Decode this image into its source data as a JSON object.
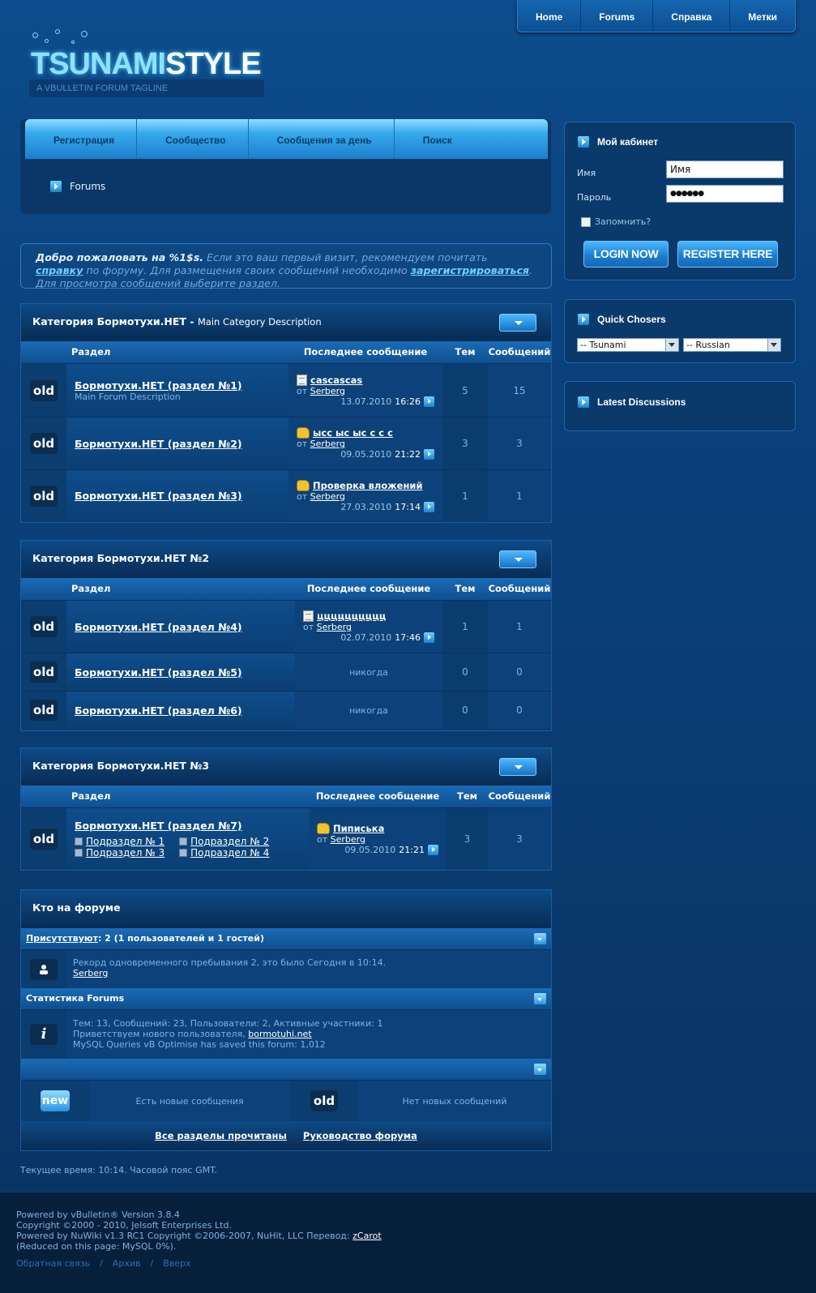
{
  "topnav": [
    "Home",
    "Forums",
    "Справка",
    "Метки"
  ],
  "logo": {
    "part1": "TSUNAMI",
    "part2": "STYLE",
    "tagline": "A VBULLETIN FORUM TAGLINE"
  },
  "mainnav": [
    "Регистрация",
    "Сообщество",
    "Сообщения за день",
    "Поиск"
  ],
  "breadcrumb": "Forums",
  "welcome": {
    "bold": "Добро пожаловать на %1$s.",
    "t1": " Если это ваш первый визит, рекомендуем почитать ",
    "link1": "справку",
    "t2": " по форуму. Для размещения своих сообщений необходимо ",
    "link2": "зарегистрироваться",
    "t3": ". Для просмотра сообщений выберите раздел."
  },
  "columns": {
    "forum": "Раздел",
    "last": "Последнее сообщение",
    "threads": "Тем",
    "posts": "Сообщений"
  },
  "status_icon": "old",
  "never": "никогда",
  "from": "от",
  "categories": [
    {
      "title": "Категория Бормотухи.НЕТ",
      "sep": " - ",
      "desc": "Main Category Description",
      "forums": [
        {
          "name": "Бормотухи.НЕТ (раздел №1)",
          "desc": "Main Forum Description",
          "icon": "doc-icon",
          "last_title": "cascascas",
          "last_user": "Serberg",
          "last_date": "13.07.2010",
          "last_time": "16:26",
          "threads": "5",
          "posts": "15"
        },
        {
          "name": "Бормотухи.НЕТ (раздел №2)",
          "desc": "",
          "icon": "thumb-icon",
          "last_title": "ысс ыс ыс с с с",
          "last_user": "Serberg",
          "last_date": "09.05.2010",
          "last_time": "21:22",
          "threads": "3",
          "posts": "3"
        },
        {
          "name": "Бормотухи.НЕТ (раздел №3)",
          "desc": "",
          "icon": "thumb-icon",
          "last_title": "Проверка вложений",
          "last_user": "Serberg",
          "last_date": "27.03.2010",
          "last_time": "17:14",
          "threads": "1",
          "posts": "1"
        }
      ]
    },
    {
      "title": "Категория Бормотухи.НЕТ №2",
      "forums": [
        {
          "name": "Бормотухи.НЕТ (раздел №4)",
          "icon": "doc-icon",
          "last_title": "цццццццццц",
          "last_user": "Serberg",
          "last_date": "02.07.2010",
          "last_time": "17:46",
          "threads": "1",
          "posts": "1"
        },
        {
          "name": "Бормотухи.НЕТ (раздел №5)",
          "threads": "0",
          "posts": "0"
        },
        {
          "name": "Бормотухи.НЕТ (раздел №6)",
          "threads": "0",
          "posts": "0"
        }
      ]
    },
    {
      "title": "Категория Бормотухи.НЕТ №3",
      "forums": [
        {
          "name": "Бормотухи.НЕТ (раздел №7)",
          "subforums": [
            "Подраздел № 1",
            "Подраздел № 2",
            "Подраздел № 3",
            "Подраздел № 4"
          ],
          "icon": "thumb-icon",
          "last_title": "Пиписька",
          "last_user": "Serberg",
          "last_date": "09.05.2010",
          "last_time": "21:21",
          "threads": "3",
          "posts": "3"
        }
      ]
    }
  ],
  "whoonline": {
    "title": "Кто на форуме",
    "present_link": "Присутствуют",
    "present_text": ": 2 (1 пользователей и 1 гостей)",
    "record": "Рекорд одновременного пребывания 2, это было Сегодня в 10:14.",
    "record_user": "Serberg",
    "stats_title": "Статистика Forums",
    "stats_line1": "Тем: 13, Сообщений: 23, Пользователи: 2, Активные участники: 1",
    "stats_line2": "Приветствуем нового пользователя, ",
    "stats_user": "bormotuhi.net",
    "stats_line3": "MySQL Queries vB Optimise has saved this forum: 1,012",
    "stats_icon": "i"
  },
  "legend": {
    "new_icon": "new",
    "new_text": "Есть новые сообщения",
    "old_icon": "old",
    "old_text": "Нет новых сообщений"
  },
  "bottomlinks": [
    "Все разделы прочитаны",
    "Руководство форума"
  ],
  "curtime": "Текущее время: 10:14. Часовой пояс GMT.",
  "rightpanel": {
    "cabinet_title": "Мой кабинет",
    "name_label": "Имя",
    "name_value": "Имя",
    "pass_label": "Пароль",
    "pass_value": "●●●●●●",
    "remember": "Запомнить?",
    "login_btn": "LOGIN NOW",
    "register_btn": "REGISTER HERE",
    "quick_title": "Quick Chosers",
    "style_select": "-- Tsunami",
    "lang_select": "-- Russian",
    "latest_title": "Latest Discussions"
  },
  "footer": {
    "l1": "Powered by vBulletin® Version 3.8.4",
    "l2": "Copyright ©2000 - 2010, Jelsoft Enterprises Ltd.",
    "l3": "Powered by NuWiki v1.3 RC1 Copyright ©2006-2007, NuHit, LLC Перевод: ",
    "l3link": "zCarot",
    "l4": "(Reduced on this page: MySQL 0%).",
    "links": [
      "Обратная связь",
      "Архив",
      "Вверх"
    ]
  }
}
